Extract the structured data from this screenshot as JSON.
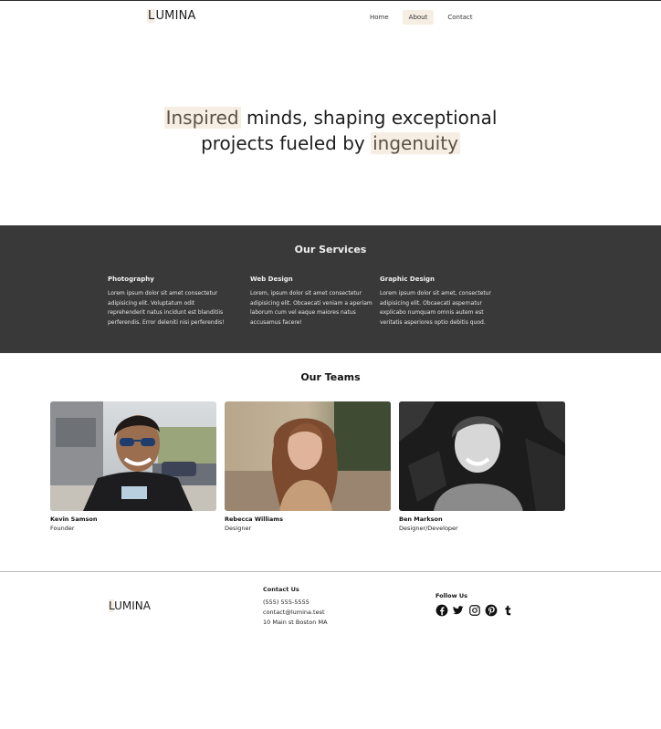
{
  "header": {
    "logo_lead": "L",
    "logo_rest": "UMINA",
    "nav": [
      {
        "label": "Home",
        "active": false
      },
      {
        "label": "About",
        "active": true
      },
      {
        "label": "Contact",
        "active": false
      }
    ]
  },
  "hero": {
    "line1_highlight": "Inspired",
    "line1_rest": " minds, shaping exceptional",
    "line2_lead": "projects fueled by ",
    "line2_highlight": "ingenuity"
  },
  "services": {
    "title": "Our Services",
    "items": [
      {
        "title": "Photography",
        "text": "Lorem ipsum dolor sit amet consectetur adipisicing elit. Voluptatum odit reprehenderit natus incidunt est blanditiis perferendis. Error deleniti nisi perferendis!"
      },
      {
        "title": "Web Design",
        "text": "Lorem, ipsum dolor sit amet consectetur adipisicing elit. Obcaecati veniam a aperiam laborum cum vel eaque maiores natus accusamus facere!"
      },
      {
        "title": "Graphic Design",
        "text": "Lorem ipsum dolor sit amet, consectetur adipisicing elit. Obcaecati aspernatur explicabo numquam omnis autem est veritatis asperiores optio debitis quod."
      }
    ]
  },
  "teams": {
    "title": "Our Teams",
    "members": [
      {
        "name": "Kevin Samson",
        "role": "Founder"
      },
      {
        "name": "Rebecca Williams",
        "role": "Designer"
      },
      {
        "name": "Ben Markson",
        "role": "Designer/Developer"
      }
    ]
  },
  "footer": {
    "logo_lead": "L",
    "logo_rest": "UMINA",
    "contact": {
      "title": "Contact Us",
      "phone": "(555) 555-5555",
      "email": "contact@lumina.test",
      "address": "10 Main st Boston MA"
    },
    "follow": {
      "title": "Follow Us",
      "icons": [
        "facebook-icon",
        "twitter-icon",
        "instagram-icon",
        "pinterest-icon",
        "tumblr-icon"
      ]
    }
  },
  "colors": {
    "accent_bg": "#f6eee3",
    "services_bg": "#393939"
  }
}
